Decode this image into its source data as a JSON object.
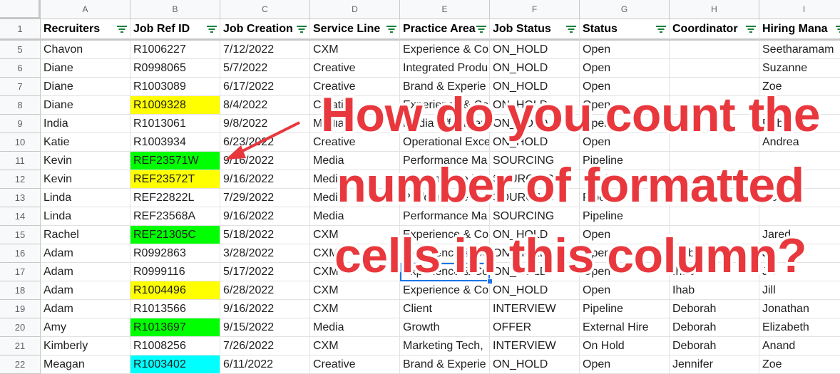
{
  "columns": [
    {
      "letter": "A",
      "header": "Recruiters"
    },
    {
      "letter": "B",
      "header": "Job Ref ID"
    },
    {
      "letter": "C",
      "header": "Job Creation"
    },
    {
      "letter": "D",
      "header": "Service Line"
    },
    {
      "letter": "E",
      "header": "Practice Area"
    },
    {
      "letter": "F",
      "header": "Job Status"
    },
    {
      "letter": "G",
      "header": "Status"
    },
    {
      "letter": "H",
      "header": "Coordinator"
    },
    {
      "letter": "I",
      "header": "Hiring Mana"
    }
  ],
  "header_row_number": "1",
  "rows": [
    {
      "num": "5",
      "cells": [
        "Chavon",
        "R1006227",
        "7/12/2022",
        "CXM",
        "Experience & Co",
        "ON_HOLD",
        "Open",
        "",
        "Seetharamam"
      ]
    },
    {
      "num": "6",
      "cells": [
        "Diane",
        "R0998065",
        "5/7/2022",
        "Creative",
        "Integrated Produ",
        "ON_HOLD",
        "Open",
        "",
        "Suzanne"
      ]
    },
    {
      "num": "7",
      "cells": [
        "Diane",
        "R1003089",
        "6/17/2022",
        "Creative",
        "Brand & Experie",
        "ON_HOLD",
        "Open",
        "",
        "Zoe"
      ]
    },
    {
      "num": "8",
      "cells": [
        "Diane",
        "R1009328",
        "8/4/2022",
        "Creative",
        "Experience & Co",
        "ON_HOLD",
        "Open",
        "",
        ""
      ]
    },
    {
      "num": "9",
      "cells": [
        "India",
        "R1013061",
        "9/8/2022",
        "Media",
        "Media Effectiven",
        "ON_HOLD",
        "Open",
        "",
        "Robert"
      ]
    },
    {
      "num": "10",
      "cells": [
        "Katie",
        "R1003934",
        "6/23/2022",
        "Creative",
        "Operational Exce",
        "ON_HOLD",
        "Open",
        "",
        "Andrea"
      ]
    },
    {
      "num": "11",
      "cells": [
        "Kevin",
        "REF23571W",
        "9/16/2022",
        "Media",
        "Performance Ma",
        "SOURCING",
        "Pipeline",
        "",
        ""
      ]
    },
    {
      "num": "12",
      "cells": [
        "Kevin",
        "REF23572T",
        "9/16/2022",
        "Media",
        "Performance Ma",
        "SOURCING",
        "Pipeline",
        "",
        ""
      ]
    },
    {
      "num": "13",
      "cells": [
        "Linda",
        "REF22822L",
        "7/29/2022",
        "Media",
        "Performance Ma",
        "SOURCING",
        "Pipeline",
        "",
        "Octavio"
      ]
    },
    {
      "num": "14",
      "cells": [
        "Linda",
        "REF23568A",
        "9/16/2022",
        "Media",
        "Performance Ma",
        "SOURCING",
        "Pipeline",
        "",
        ""
      ]
    },
    {
      "num": "15",
      "cells": [
        "Rachel",
        "REF21305C",
        "5/18/2022",
        "CXM",
        "Experience & Co",
        "ON_HOLD",
        "Open",
        "",
        "Jared"
      ]
    },
    {
      "num": "16",
      "cells": [
        "Adam",
        "R0992863",
        "3/28/2022",
        "CXM",
        "Experience & Co",
        "ON_HOLD",
        "Open",
        "Ihab",
        "Jill"
      ]
    },
    {
      "num": "17",
      "cells": [
        "Adam",
        "R0999116",
        "5/17/2022",
        "CXM",
        "Experience & Co",
        "ON_HOLD",
        "Open",
        "Ihab",
        "Jill"
      ]
    },
    {
      "num": "18",
      "cells": [
        "Adam",
        "R1004496",
        "6/28/2022",
        "CXM",
        "Experience & Co",
        "ON_HOLD",
        "Open",
        "Ihab",
        "Jill"
      ]
    },
    {
      "num": "19",
      "cells": [
        "Adam",
        "R1013566",
        "9/16/2022",
        "CXM",
        "Client",
        "INTERVIEW",
        "Pipeline",
        "Deborah",
        "Jonathan"
      ]
    },
    {
      "num": "20",
      "cells": [
        "Amy",
        "R1013697",
        "9/15/2022",
        "Media",
        "Growth",
        "OFFER",
        "External Hire",
        "Deborah",
        "Elizabeth"
      ]
    },
    {
      "num": "21",
      "cells": [
        "Kimberly",
        "R1008256",
        "7/26/2022",
        "CXM",
        "Marketing Tech,",
        "INTERVIEW",
        "On Hold",
        "Deborah",
        "Anand"
      ]
    },
    {
      "num": "22",
      "cells": [
        "Meagan",
        "R1003402",
        "6/11/2022",
        "Creative",
        "Brand & Experie",
        "ON_HOLD",
        "Open",
        "Jennifer",
        "Zoe"
      ]
    }
  ],
  "highlights": {
    "8": "#ffff00",
    "11": "#00ff00",
    "12": "#ffff00",
    "15": "#00ff00",
    "18": "#ffff00",
    "20": "#00ff00",
    "22": "#00ffff"
  },
  "selected_cell": {
    "row": "17",
    "col": "E"
  },
  "overlay_text": [
    "How do you count the",
    "number of formatted",
    "cells in this column?"
  ],
  "colors": {
    "overlay": "#e8383d",
    "arrow": "#e8383d",
    "filter_icon": "#188038",
    "selection": "#1a73e8"
  }
}
